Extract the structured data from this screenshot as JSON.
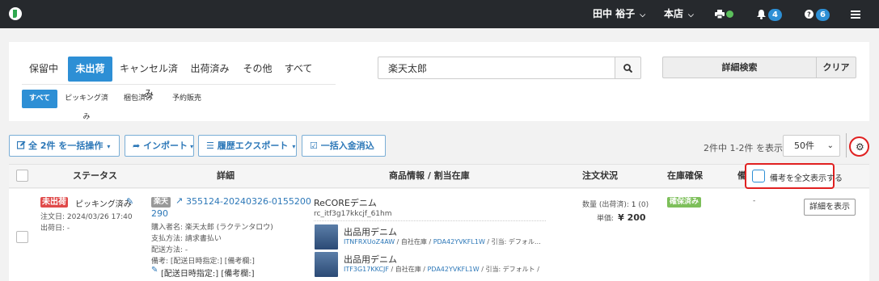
{
  "topbar": {
    "user_name": "田中 裕子",
    "store": "本店",
    "notification_count": "4",
    "help_count": "6",
    "accent": "#2d8fd5"
  },
  "tabs": [
    "保留中",
    "未出荷",
    "キャンセル済み",
    "出荷済み",
    "その他",
    "すべて"
  ],
  "subtabs": [
    "すべて",
    "ピッキング済み",
    "梱包済み",
    "予約販売"
  ],
  "search": {
    "value": "楽天太郎"
  },
  "buttons": {
    "advanced_search": "詳細検索",
    "clear": "クリア"
  },
  "toolbar": {
    "bulk": "全 2件 を一括操作",
    "import": "インポート",
    "export": "履歴エクスポート",
    "payment": "一括入金消込"
  },
  "pagination": {
    "count_text": "2件中 1-2件 を表示",
    "per_page": "50件"
  },
  "columns": {
    "status": "ステータス",
    "detail": "詳細",
    "product": "商品情報 / 割当在庫",
    "order_status": "注文状況",
    "stock": "在庫確保",
    "remarks_partial": "備"
  },
  "popover": {
    "label": "備考を全文表示する"
  },
  "row": {
    "status_badge": "未出荷",
    "status_text": "ピッキング済み",
    "order_date": "注文日: 2024/03/26 17:40",
    "ship_date": "出荷日: -",
    "shop_tag": "楽天",
    "order_id_line1": "355124-20240326-0155200",
    "order_id_line2": "290",
    "buyer": "購入者名: 楽天太郎 (ラクテンタロウ)",
    "payment": "支払方法: 請求書払い",
    "delivery": "配送方法: -",
    "memo": "備考: [配送日時指定:] [備考欄:]",
    "memo_edit": "[配送日時指定:] [備考欄:]",
    "product_name": "ReCOREデニム",
    "product_code": "rc_itf3g17kkcjf_61hm",
    "quantity_label": "数量 (出荷済):",
    "quantity_value": "1",
    "quantity_shipped": "(0)",
    "price_label": "単価:",
    "price_value": "¥ 200",
    "stock_badge": "確保済み",
    "remarks": "-",
    "detail_button": "詳細を表示",
    "items": [
      {
        "name": "出品用デニム",
        "code": "ITNFRXUoZ4AW",
        "location": "自社在庫",
        "pda": "PDA42YVKFL1W",
        "suffix": "/ 引当: デフォル…"
      },
      {
        "name": "出品用デニム",
        "code": "ITF3G17KKCJF",
        "location": "自社在庫",
        "pda": "PDA42YVKFL1W",
        "suffix": "/ 引当: デフォルト /"
      }
    ]
  }
}
